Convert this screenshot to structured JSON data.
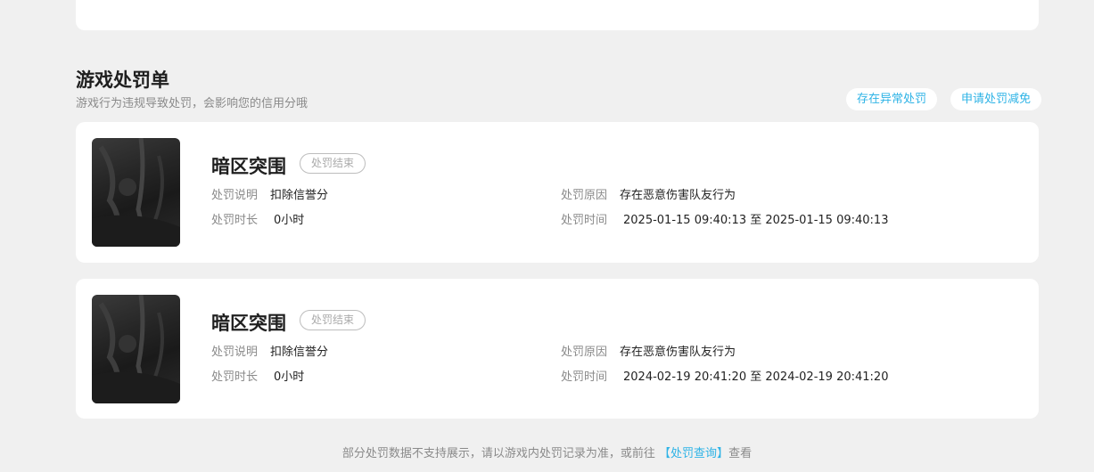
{
  "section": {
    "title": "游戏处罚单",
    "subtitle": "游戏行为违规导致处罚，会影响您的信用分哦"
  },
  "actions": {
    "report_abnormal": "存在异常处罚",
    "apply_reduction": "申请处罚减免"
  },
  "labels": {
    "description": "处罚说明",
    "duration": "处罚时长",
    "reason": "处罚原因",
    "time": "处罚时间",
    "to": "至"
  },
  "records": [
    {
      "game": "暗区突围",
      "status": "处罚结束",
      "description": "扣除信誉分",
      "duration": "0小时",
      "reason": "存在恶意伤害队友行为",
      "start": "2025-01-15 09:40:13",
      "end": "2025-01-15 09:40:13"
    },
    {
      "game": "暗区突围",
      "status": "处罚结束",
      "description": "扣除信誉分",
      "duration": "0小时",
      "reason": "存在恶意伤害队友行为",
      "start": "2024-02-19 20:41:20",
      "end": "2024-02-19 20:41:20"
    }
  ],
  "footer": {
    "prefix": "部分处罚数据不支持展示，请以游戏内处罚记录为准，或前往 ",
    "link": "【处罚查询】",
    "suffix": "查看"
  }
}
